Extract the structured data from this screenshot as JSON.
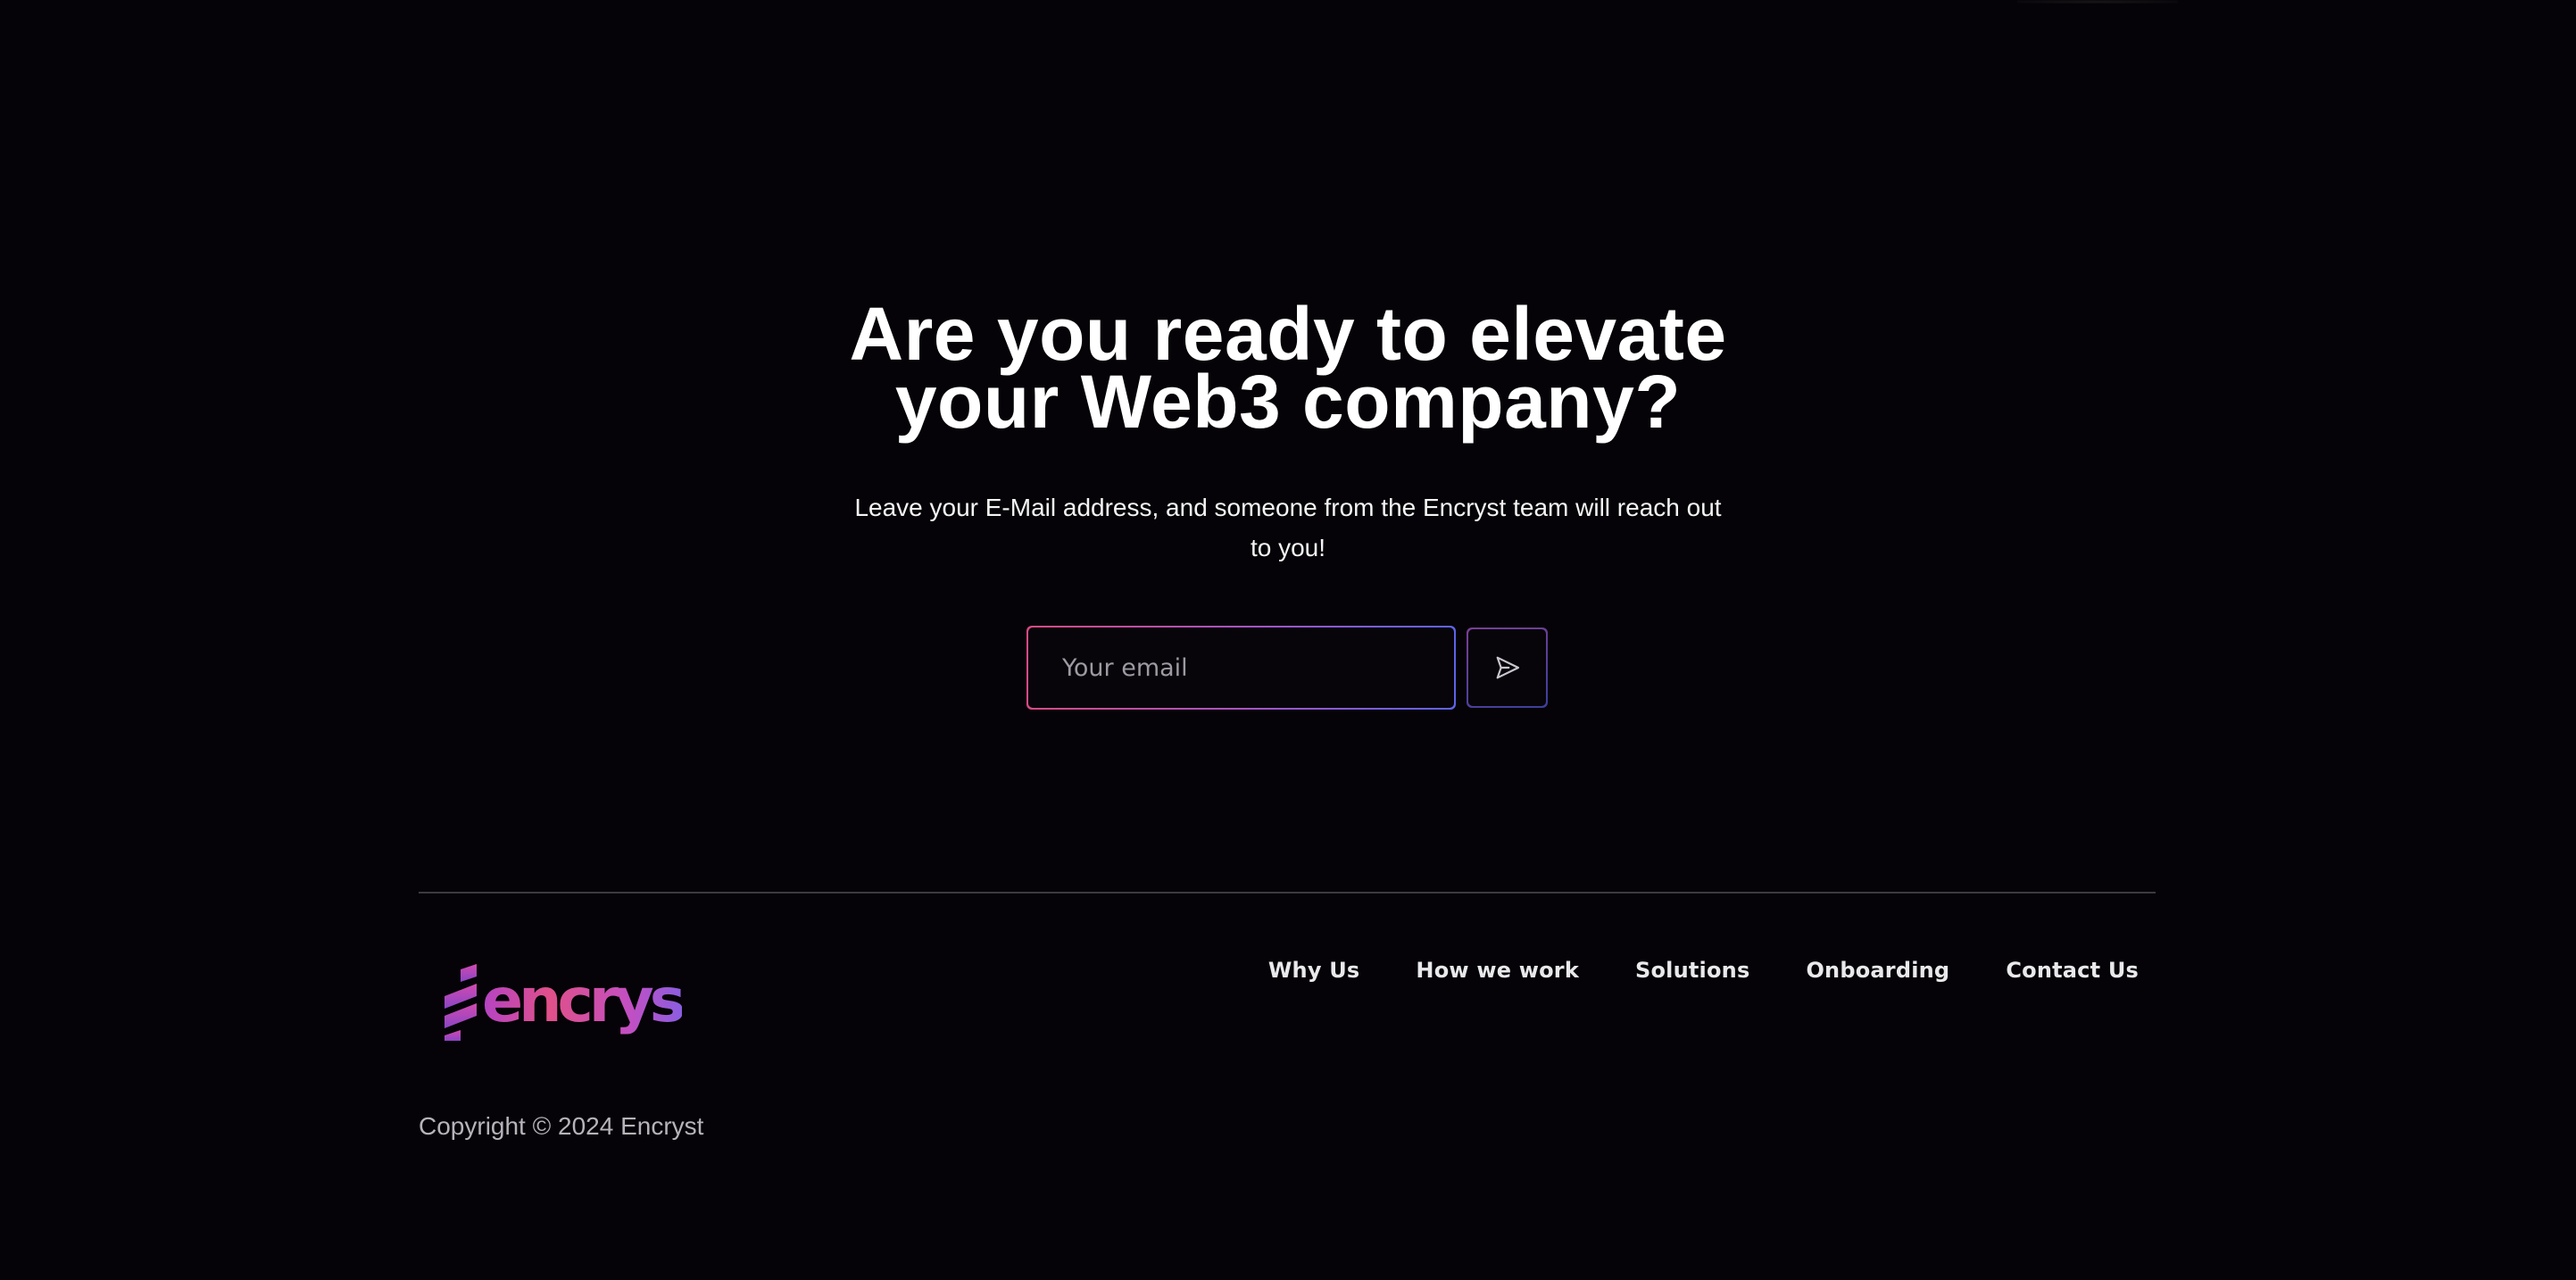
{
  "hero": {
    "headline_line1": "Are you ready to elevate",
    "headline_line2": "your Web3 company?",
    "subtitle": "Leave your E-Mail address, and someone from the Encryst team will reach out to you!"
  },
  "form": {
    "email_placeholder": "Your email",
    "email_value": "",
    "submit_icon": "send-icon"
  },
  "footer": {
    "logo_text": "encryst",
    "nav": [
      {
        "label": "Why Us"
      },
      {
        "label": "How we work"
      },
      {
        "label": "Solutions"
      },
      {
        "label": "Onboarding"
      },
      {
        "label": "Contact Us"
      }
    ],
    "copyright": "Copyright © 2024 Encryst"
  },
  "colors": {
    "background": "#050307",
    "brand_pink": "#e14b86",
    "brand_purple": "#a04fd0",
    "brand_blue": "#6b63ee",
    "text_primary": "#ffffff",
    "text_muted": "#b6b3bb"
  }
}
